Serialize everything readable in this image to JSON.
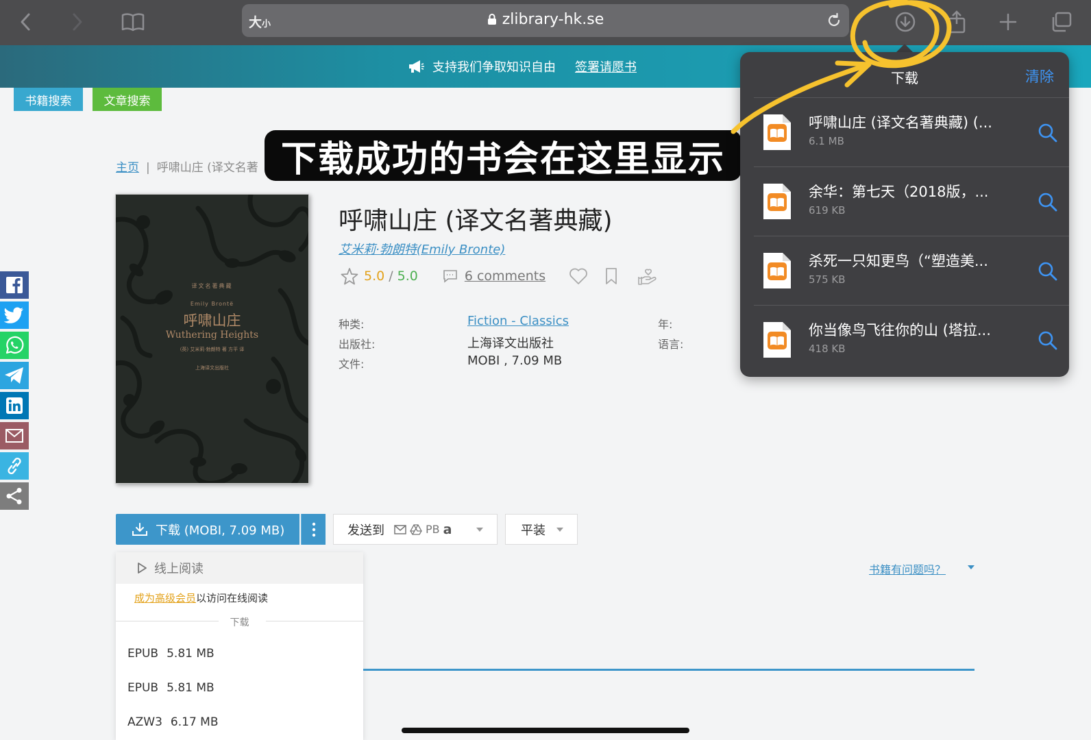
{
  "browser": {
    "text_size_label": "大",
    "text_size_small": "小",
    "url": "zlibrary-hk.se"
  },
  "banner": {
    "message": "支持我们争取知识自由",
    "link": "签署请愿书"
  },
  "tabs": {
    "book_search": "书籍搜索",
    "article_search": "文章搜索"
  },
  "breadcrumb": {
    "home": "主页",
    "separator": "|",
    "current": "呼啸山庄 (译文名著"
  },
  "caption": "下载成功的书会在这里显示",
  "cover": {
    "series": "译文名著典藏",
    "author": "Emily Brontë",
    "title_cn": "呼啸山庄",
    "title_en": "Wuthering Heights",
    "translator": "(英) 艾米莉·勃朗特 著  方平 译",
    "publisher": "上海译文出版社"
  },
  "book": {
    "title": "呼啸山庄 (译文名著典藏)",
    "author": "艾米莉·勃朗特(Emily Bronte)",
    "rating_value": "5.0",
    "rating_sep": "/",
    "rating_max": "5.0",
    "comments": "6 comments",
    "props": {
      "category_label": "种类:",
      "category_value": "Fiction - Classics",
      "publisher_label": "出版社:",
      "publisher_value": "上海译文出版社",
      "file_label": "文件:",
      "file_value": "MOBI , 7.09 MB",
      "year_label": "年:",
      "language_label": "语言:"
    }
  },
  "actions": {
    "download": "下载 (MOBI, 7.09 MB)",
    "send_to": "发送到",
    "send_pb": "PB",
    "send_amazon": "a",
    "binding": "平装"
  },
  "dropdown": {
    "read_online": "线上阅读",
    "premium_link": "成为高级会员",
    "premium_suffix": "以访问在线阅读",
    "download_label": "下载",
    "formats": [
      {
        "format": "EPUB",
        "size": "5.81 MB"
      },
      {
        "format": "EPUB",
        "size": "5.81 MB"
      },
      {
        "format": "AZW3",
        "size": "6.17 MB"
      }
    ]
  },
  "problem_link": "书籍有问题吗？",
  "downloads_popover": {
    "title": "下载",
    "clear": "清除",
    "items": [
      {
        "name": "呼啸山庄 (译文名著典藏) (...",
        "size": "6.1 MB"
      },
      {
        "name": "余华：第七天（2018版，...",
        "size": "619 KB"
      },
      {
        "name": "杀死一只知更鸟（“塑造美...",
        "size": "575 KB"
      },
      {
        "name": "你当像鸟飞往你的山 (塔拉...",
        "size": "418 KB"
      }
    ]
  },
  "share_icons": [
    "facebook-icon",
    "twitter-icon",
    "whatsapp-icon",
    "telegram-icon",
    "linkedin-icon",
    "email-icon",
    "link-icon",
    "share-icon"
  ],
  "colors": {
    "accent_blue": "#3d96ca",
    "book_search_tab": "#38a8cf",
    "article_search_tab": "#5dbb3d",
    "rating_orange": "#e3a21b",
    "annotation_yellow": "#f6c22e",
    "popover_bg": "#3f3f42",
    "ios_blue": "#3e95f5"
  }
}
